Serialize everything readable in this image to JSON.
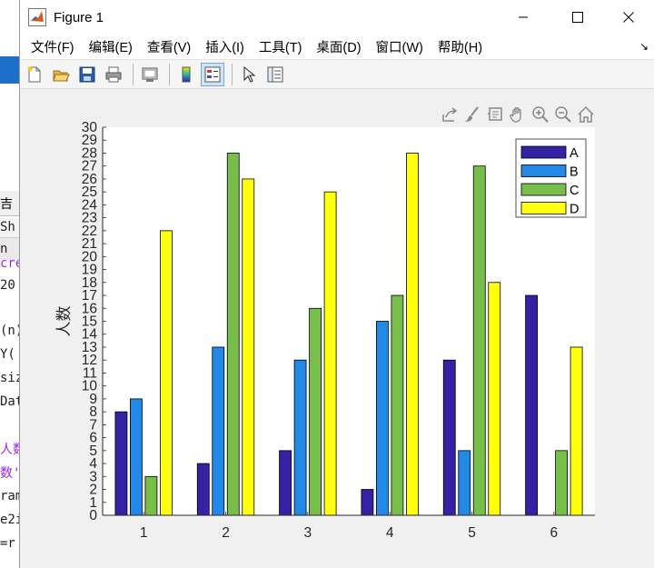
{
  "window": {
    "title": "Figure 1",
    "minimize_glyph": "—",
    "maximize_glyph": "☐",
    "close_glyph": "✕"
  },
  "menubar": {
    "items": [
      "文件(F)",
      "编辑(E)",
      "查看(V)",
      "插入(I)",
      "工具(T)",
      "桌面(D)",
      "窗口(W)",
      "帮助(H)"
    ],
    "dock_glyph": "↘"
  },
  "toolbar": {
    "buttons": [
      "new-figure-icon",
      "open-file-icon",
      "save-icon",
      "print-icon",
      "link-plot-icon",
      "colorbar-icon",
      "legend-icon",
      "pointer-icon",
      "property-inspector-icon"
    ]
  },
  "axes_toolbar": {
    "buttons": [
      "export-icon",
      "brush-icon",
      "data-tips-icon",
      "pan-icon",
      "zoom-in-icon",
      "zoom-out-icon",
      "home-icon"
    ]
  },
  "background_editor": {
    "tab_text": "吉",
    "lines": [
      "Sh",
      "n",
      "cre",
      "20",
      "(n)",
      "Y(",
      "siz",
      "Dat",
      "人数",
      "数'",
      "ram",
      "e2i",
      "=r"
    ]
  },
  "colors": {
    "A": "#3421a3",
    "B": "#2389e6",
    "C": "#77bf4a",
    "D": "#ffff0e"
  },
  "chart_data": {
    "type": "bar",
    "categories": [
      "1",
      "2",
      "3",
      "4",
      "5",
      "6"
    ],
    "series": [
      {
        "name": "A",
        "values": [
          8,
          4,
          5,
          2,
          12,
          17
        ]
      },
      {
        "name": "B",
        "values": [
          9,
          13,
          12,
          15,
          5,
          0
        ]
      },
      {
        "name": "C",
        "values": [
          3,
          28,
          16,
          17,
          27,
          5
        ]
      },
      {
        "name": "D",
        "values": [
          22,
          26,
          25,
          28,
          18,
          13
        ]
      }
    ],
    "ylabel": "人数",
    "xlabel": "",
    "title": "",
    "ylim": [
      0,
      30
    ],
    "yticks": [
      0,
      1,
      2,
      3,
      4,
      5,
      6,
      7,
      8,
      9,
      10,
      11,
      12,
      13,
      14,
      15,
      16,
      17,
      18,
      19,
      20,
      21,
      22,
      23,
      24,
      25,
      26,
      27,
      28,
      29,
      30
    ],
    "grid": false,
    "legend_position": "top-right"
  }
}
